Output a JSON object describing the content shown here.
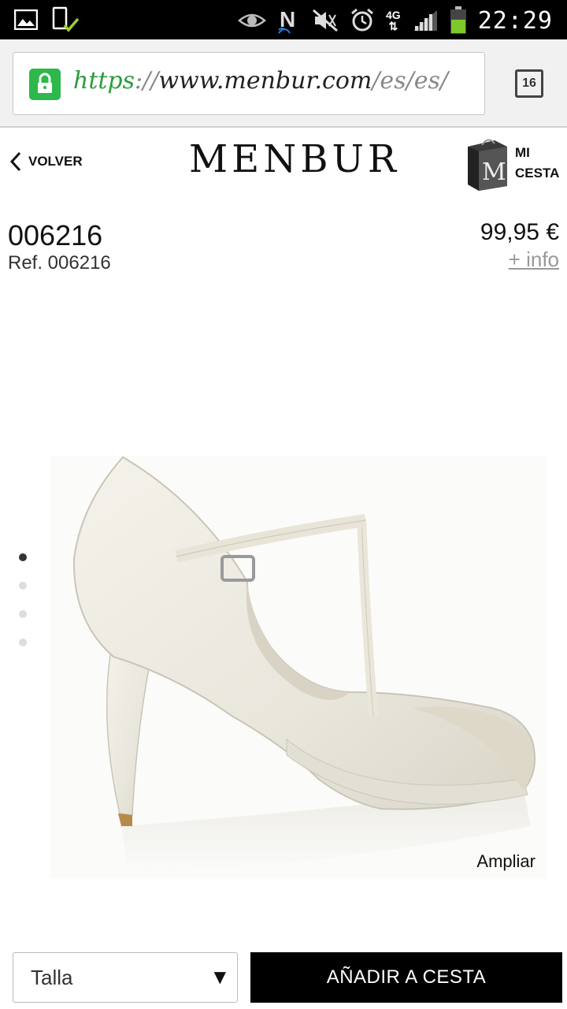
{
  "status_bar": {
    "time": "22:29",
    "network": "4G",
    "icons": [
      "gallery-icon",
      "download-complete-icon",
      "eye-icon",
      "nfc-icon",
      "mute-icon",
      "alarm-icon",
      "signal-icon",
      "battery-icon"
    ]
  },
  "browser": {
    "url_protocol": "https",
    "url_sep": "://",
    "url_host": "www.menbur.com",
    "url_path": "/es/es/",
    "tab_count": "16",
    "lock_color": "#2db84b"
  },
  "header": {
    "back_label": "VOLVER",
    "logo": "MENBUR",
    "cart_line1": "MI",
    "cart_line2": "CESTA"
  },
  "product": {
    "name": "006216",
    "ref": "Ref. 006216",
    "price": "99,95 €",
    "more_info": "+ info",
    "zoom_label": "Ampliar",
    "gallery_count": 4,
    "gallery_active": 1
  },
  "actions": {
    "size_placeholder": "Talla",
    "add_to_cart": "AÑADIR A CESTA"
  }
}
